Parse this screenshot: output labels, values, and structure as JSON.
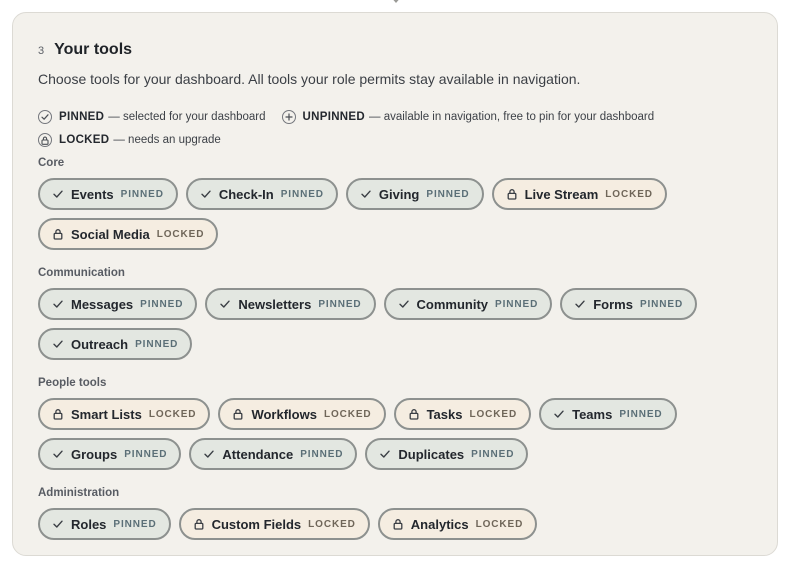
{
  "section": {
    "step": "3",
    "title": "Your tools",
    "description": "Choose tools for your dashboard. All tools your role permits stay available in navigation."
  },
  "legend": {
    "pinned": {
      "label": "PINNED",
      "text": "— selected for your dashboard",
      "icon": "check-circle-icon"
    },
    "unpinned": {
      "label": "UNPINNED",
      "text": "— available in navigation, free to pin for your dashboard",
      "icon": "plus-circle-icon"
    },
    "locked": {
      "label": "LOCKED",
      "text": "— needs an upgrade",
      "icon": "lock-circle-icon"
    }
  },
  "groups": [
    {
      "label": "Core",
      "tools": [
        {
          "name": "Events",
          "status": "PINNED"
        },
        {
          "name": "Check-In",
          "status": "PINNED"
        },
        {
          "name": "Giving",
          "status": "PINNED"
        },
        {
          "name": "Live Stream",
          "status": "LOCKED"
        },
        {
          "name": "Social Media",
          "status": "LOCKED"
        }
      ]
    },
    {
      "label": "Communication",
      "tools": [
        {
          "name": "Messages",
          "status": "PINNED"
        },
        {
          "name": "Newsletters",
          "status": "PINNED"
        },
        {
          "name": "Community",
          "status": "PINNED"
        },
        {
          "name": "Forms",
          "status": "PINNED"
        },
        {
          "name": "Outreach",
          "status": "PINNED"
        }
      ]
    },
    {
      "label": "People tools",
      "tools": [
        {
          "name": "Smart Lists",
          "status": "LOCKED"
        },
        {
          "name": "Workflows",
          "status": "LOCKED"
        },
        {
          "name": "Tasks",
          "status": "LOCKED"
        },
        {
          "name": "Teams",
          "status": "PINNED"
        },
        {
          "name": "Groups",
          "status": "PINNED"
        },
        {
          "name": "Attendance",
          "status": "PINNED"
        },
        {
          "name": "Duplicates",
          "status": "PINNED"
        }
      ]
    },
    {
      "label": "Administration",
      "tools": [
        {
          "name": "Roles",
          "status": "PINNED"
        },
        {
          "name": "Custom Fields",
          "status": "LOCKED"
        },
        {
          "name": "Analytics",
          "status": "LOCKED"
        }
      ]
    }
  ],
  "colors": {
    "card_bg": "#f3f1ec",
    "pinned_bg": "#e3e7e1",
    "locked_bg": "#f5ede1",
    "chip_border": "#8d918f"
  }
}
